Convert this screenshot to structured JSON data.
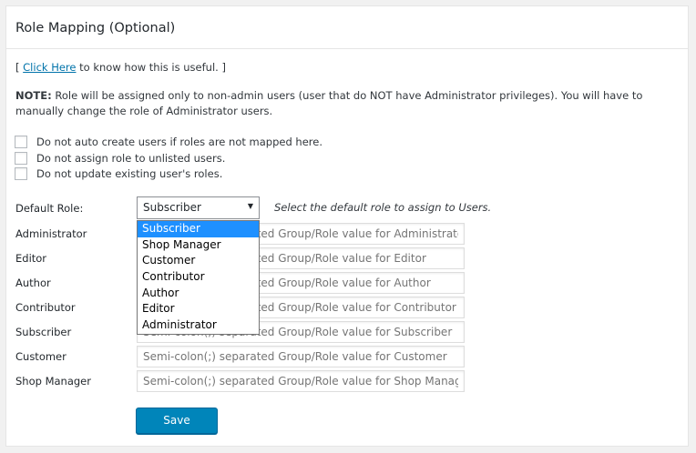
{
  "panel": {
    "title": "Role Mapping (Optional)"
  },
  "help": {
    "prefix": "[ ",
    "link_text": "Click Here",
    "suffix": " to know how this is useful. ]"
  },
  "note": {
    "label": "NOTE:",
    "text": " Role will be assigned only to non-admin users (user that do NOT have Administrator privileges). You will have to manually change the role of Administrator users."
  },
  "checkboxes": [
    {
      "label": "Do not auto create users if roles are not mapped here.",
      "checked": false
    },
    {
      "label": "Do not assign role to unlisted users.",
      "checked": false
    },
    {
      "label": "Do not update existing user's roles.",
      "checked": false
    }
  ],
  "default_role": {
    "label": "Default Role:",
    "selected": "Subscriber",
    "hint": "Select the default role to assign to Users.",
    "options": [
      "Subscriber",
      "Shop Manager",
      "Customer",
      "Contributor",
      "Author",
      "Editor",
      "Administrator"
    ]
  },
  "role_fields": [
    {
      "label": "Administrator",
      "value": "",
      "placeholder": "Semi-colon(;) separated Group/Role value for Administrator"
    },
    {
      "label": "Editor",
      "value": "",
      "placeholder": "Semi-colon(;) separated Group/Role value for Editor"
    },
    {
      "label": "Author",
      "value": "",
      "placeholder": "Semi-colon(;) separated Group/Role value for Author"
    },
    {
      "label": "Contributor",
      "value": "",
      "placeholder": "Semi-colon(;) separated Group/Role value for Contributor"
    },
    {
      "label": "Subscriber",
      "value": "",
      "placeholder": "Semi-colon(;) separated Group/Role value for Subscriber"
    },
    {
      "label": "Customer",
      "value": "",
      "placeholder": "Semi-colon(;) separated Group/Role value for Customer"
    },
    {
      "label": "Shop Manager",
      "value": "",
      "placeholder": "Semi-colon(;) separated Group/Role value for Shop Manager"
    }
  ],
  "save_label": "Save",
  "colors": {
    "primary_button": "#0085ba",
    "link": "#0073aa",
    "dropdown_highlight": "#1e90ff"
  }
}
